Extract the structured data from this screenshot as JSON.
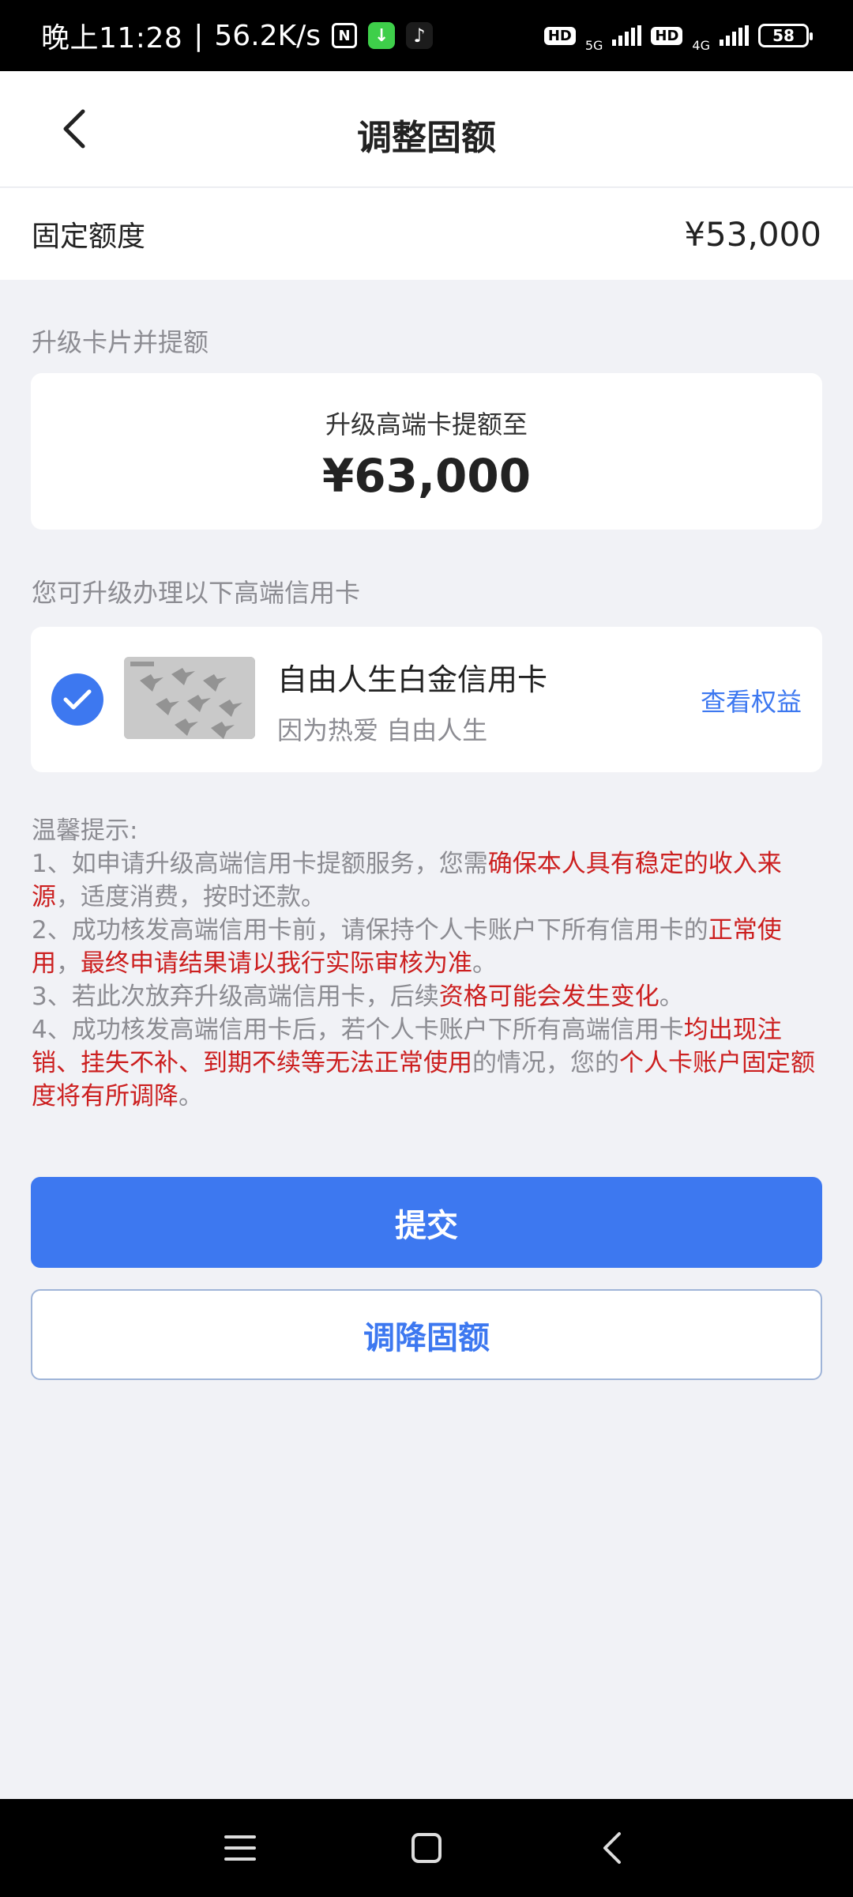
{
  "status_bar": {
    "time": "晚上11:28",
    "speed": "56.2K/s",
    "signal1_label": "5G",
    "signal2_label": "4G",
    "hd_label": "HD",
    "battery": "58"
  },
  "header": {
    "title": "调整固额"
  },
  "fixed_limit": {
    "label": "固定额度",
    "value": "¥53,000"
  },
  "upgrade_section": {
    "title": "升级卡片并提额",
    "subtitle": "升级高端卡提额至",
    "amount": "¥63,000"
  },
  "card_section": {
    "title": "您可升级办理以下高端信用卡",
    "card_name": "自由人生白金信用卡",
    "card_slogan": "因为热爱 自由人生",
    "benefits_link": "查看权益"
  },
  "tips": {
    "heading": "温馨提示:",
    "t1_a": "1、如申请升级高端信用卡提额服务，您需",
    "t1_hl": "确保本人具有稳定的收入来源",
    "t1_b": "，适度消费，按时还款。",
    "t2_a": "2、成功核发高端信用卡前，请保持个人卡账户下所有信用卡的",
    "t2_hl1": "正常使用",
    "t2_b": "，",
    "t2_hl2": "最终申请结果请以我行实际审核为准",
    "t2_c": "。",
    "t3_a": "3、若此次放弃升级高端信用卡，后续",
    "t3_hl": "资格可能会发生变化",
    "t3_b": "。",
    "t4_a": "4、成功核发高端信用卡后，若个人卡账户下所有高端信用卡",
    "t4_hl1": "均出现注销、挂失不补、到期不续等无法正常使用",
    "t4_b": "的情况，您的",
    "t4_hl2": "个人卡账户固定额度将有所调降",
    "t4_c": "。"
  },
  "buttons": {
    "submit": "提交",
    "reduce": "调降固额"
  },
  "colors": {
    "accent": "#3d78f0",
    "highlight": "#cc1f1f",
    "background": "#f1f2f6"
  },
  "icons": {
    "back": "chevron-left-icon",
    "check": "check-circle-icon",
    "nav_menu": "menu-icon",
    "nav_home": "home-icon",
    "nav_back": "back-icon"
  }
}
